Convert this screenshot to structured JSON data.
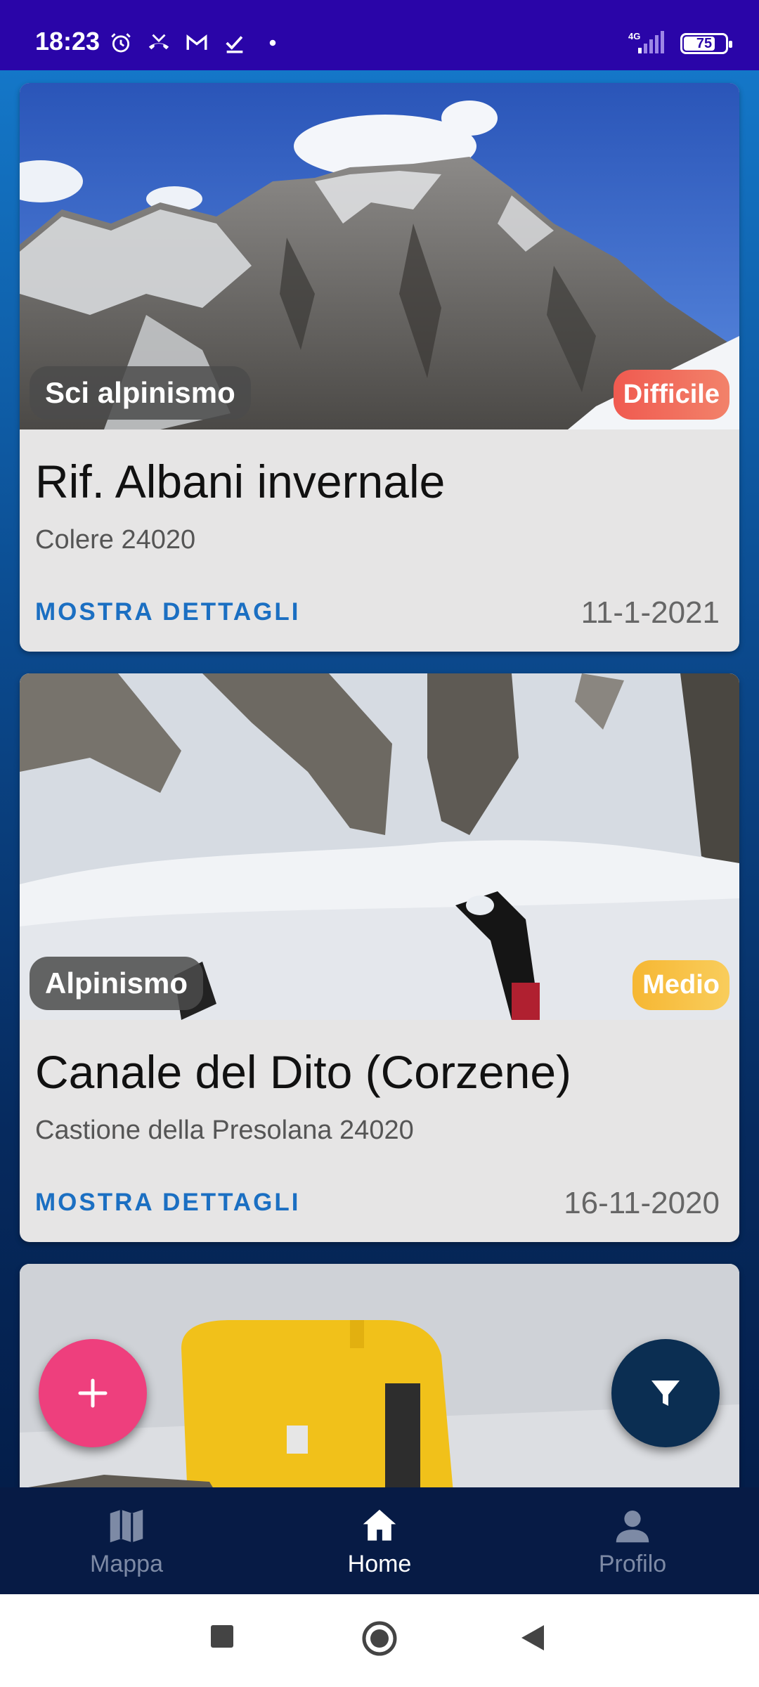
{
  "status_bar": {
    "time": "18:23",
    "network": "4G",
    "battery": "75",
    "battery_level": 0.75,
    "icons": [
      "alarm-icon",
      "missed-call-icon",
      "gmail-icon",
      "tasks-check-icon",
      "dot-icon"
    ]
  },
  "cards": [
    {
      "category": "Sci alpinismo",
      "difficulty": "Difficile",
      "title": "Rif. Albani invernale",
      "location": "Colere 24020",
      "link_label": "MOSTRA DETTAGLI",
      "date": "11-1-2021",
      "image_desc": "snowy rocky mountain under blue sky"
    },
    {
      "category": "Alpinismo",
      "difficulty": "Medio",
      "title": "Canale del Dito (Corzene)",
      "location": "Castione della Presolana 24020",
      "link_label": "MOSTRA DETTAGLI",
      "date": "16-11-2020",
      "image_desc": "snowy couloir with ice axe"
    },
    {
      "image_desc": "yellow bivouac hut"
    }
  ],
  "fab": {
    "add_icon": "plus-icon",
    "filter_icon": "filter-icon"
  },
  "bottom_nav": {
    "items": [
      {
        "label": "Mappa",
        "icon": "map-icon",
        "active": false
      },
      {
        "label": "Home",
        "icon": "home-icon",
        "active": true
      },
      {
        "label": "Profilo",
        "icon": "person-icon",
        "active": false
      }
    ]
  },
  "colors": {
    "status_bar": "#2a05a8",
    "accent_link": "#1b6fc2",
    "fab_add": "#ee3f7d",
    "fab_filter": "#0b2e52",
    "difficulty_hard": "#f05a50",
    "difficulty_medium": "#f6b733",
    "nav_bg": "#071b45"
  }
}
